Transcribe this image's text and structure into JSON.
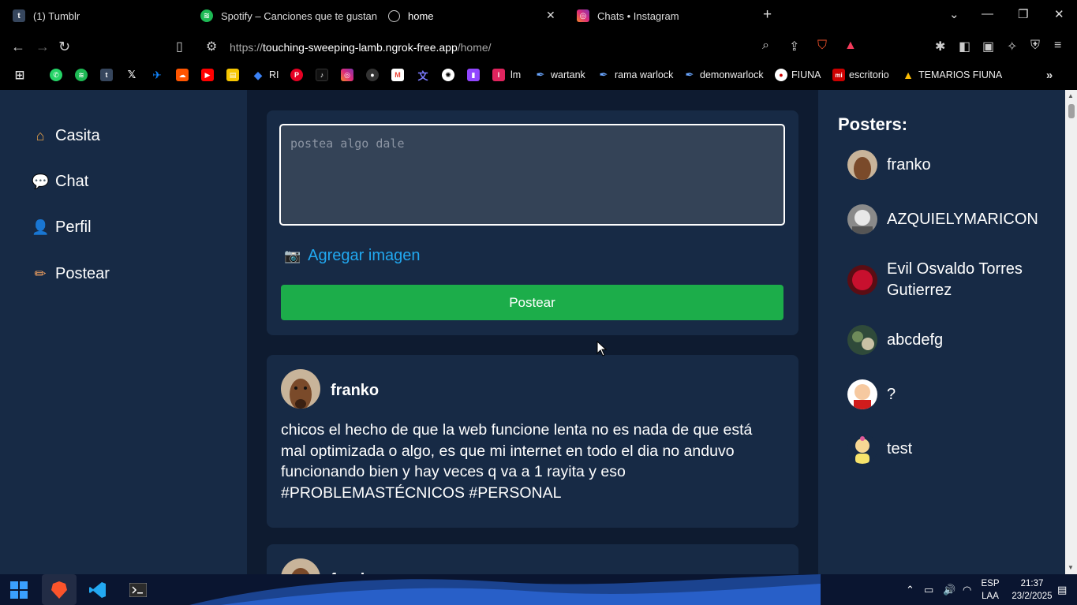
{
  "browser": {
    "tabs": [
      {
        "title": "(1) Tumblr",
        "icon": "tumblr-icon",
        "color": "#36465d"
      },
      {
        "title": "Spotify – Canciones que te gustan",
        "icon": "spotify-icon",
        "color": "#1db954"
      },
      {
        "title": "home",
        "icon": "globe-icon",
        "color": "#ffffff"
      },
      {
        "title": "Chats • Instagram",
        "icon": "instagram-icon",
        "color": "#e1306c"
      }
    ],
    "url_prefix": "https://",
    "url_host": "touching-sweeping-lamb.ngrok-free.app",
    "url_path": "/home/",
    "bookmarks": [
      "RI",
      "lm",
      "wartank",
      "rama warlock",
      "demonwarlock",
      "FIUNA",
      "escritorio",
      "TEMARIOS FIUNA"
    ]
  },
  "nav": {
    "items": [
      {
        "label": "Casita",
        "icon": "house-icon"
      },
      {
        "label": "Chat",
        "icon": "speech-bubble-icon"
      },
      {
        "label": "Perfil",
        "icon": "user-icon"
      },
      {
        "label": "Postear",
        "icon": "pencil-icon"
      }
    ]
  },
  "composer": {
    "placeholder": "postea algo dale",
    "add_image": "Agregar imagen",
    "post_button": "Postear"
  },
  "posts": [
    {
      "author": "franko",
      "body": "chicos el hecho de que la web funcione lenta no es nada de que está mal optimizada o algo, es que mi internet en todo el dia no anduvo funcionando bien y hay veces q va a 1 rayita y eso #PROBLEMASTÉCNICOS #PERSONAL"
    },
    {
      "author": "franko",
      "body": ""
    }
  ],
  "posters": {
    "title": "Posters:",
    "items": [
      "franko",
      "AZQUIELYMARICON",
      "Evil Osvaldo Torres Gutierrez",
      "abcdefg",
      "?",
      "test"
    ]
  },
  "taskbar": {
    "language": "ESP",
    "layout": "LAA",
    "time": "21:37",
    "date": "23/2/2025"
  },
  "colors": {
    "page_bg": "#172a45",
    "feed_bg": "#0e1b30",
    "post_button": "#1cad4a",
    "link": "#21a8f0"
  }
}
